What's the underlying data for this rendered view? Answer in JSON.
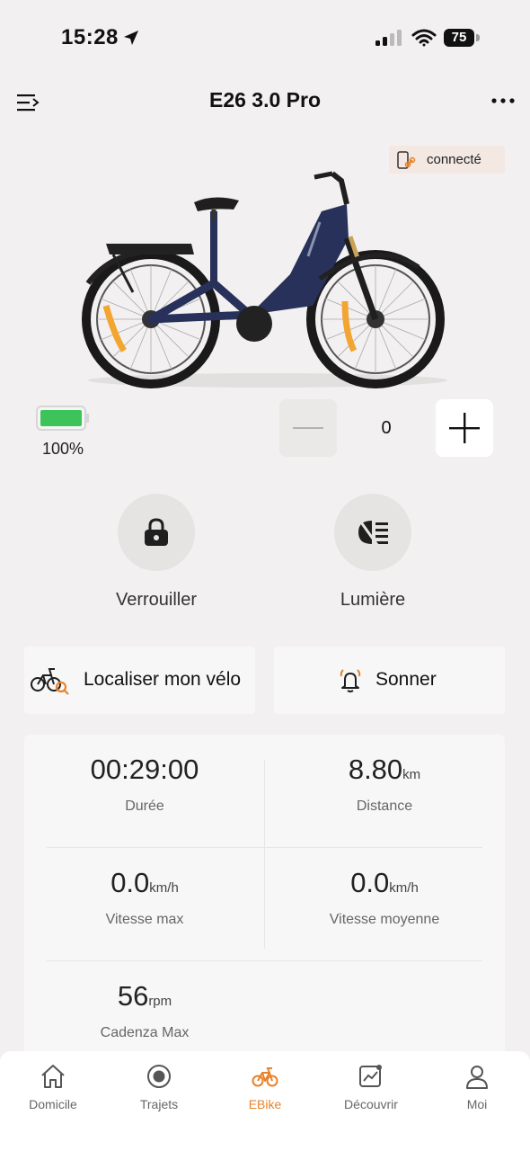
{
  "status_bar": {
    "time": "15:28",
    "battery": "75"
  },
  "header": {
    "title": "E26 3.0 Pro"
  },
  "connection": {
    "label": "connecté"
  },
  "bike": {
    "battery_percent": "100%",
    "battery_level": 1.0,
    "assist_level": "0"
  },
  "actions": {
    "lock_label": "Verrouiller",
    "light_label": "Lumière",
    "locate_label": "Localiser mon vélo",
    "ring_label": "Sonner"
  },
  "stats": {
    "duration": {
      "value": "00:29:00",
      "label": "Durée"
    },
    "distance": {
      "value": "8.80",
      "unit": "km",
      "label": "Distance"
    },
    "max_speed": {
      "value": "0.0",
      "unit": "km/h",
      "label": "Vitesse max"
    },
    "avg_speed": {
      "value": "0.0",
      "unit": "km/h",
      "label": "Vitesse moyenne"
    },
    "max_cadence": {
      "value": "56",
      "unit": "rpm",
      "label": "Cadenza Max"
    }
  },
  "nav": {
    "items": [
      {
        "label": "Domicile",
        "icon": "home-icon"
      },
      {
        "label": "Trajets",
        "icon": "record-icon"
      },
      {
        "label": "EBike",
        "icon": "bike-icon"
      },
      {
        "label": "Découvrir",
        "icon": "chart-icon"
      },
      {
        "label": "Moi",
        "icon": "user-icon"
      }
    ],
    "active_index": 2
  },
  "colors": {
    "accent": "#e8822a",
    "battery_green": "#3cc45a",
    "bike_body": "#27315a",
    "background": "#f2f0f0"
  }
}
